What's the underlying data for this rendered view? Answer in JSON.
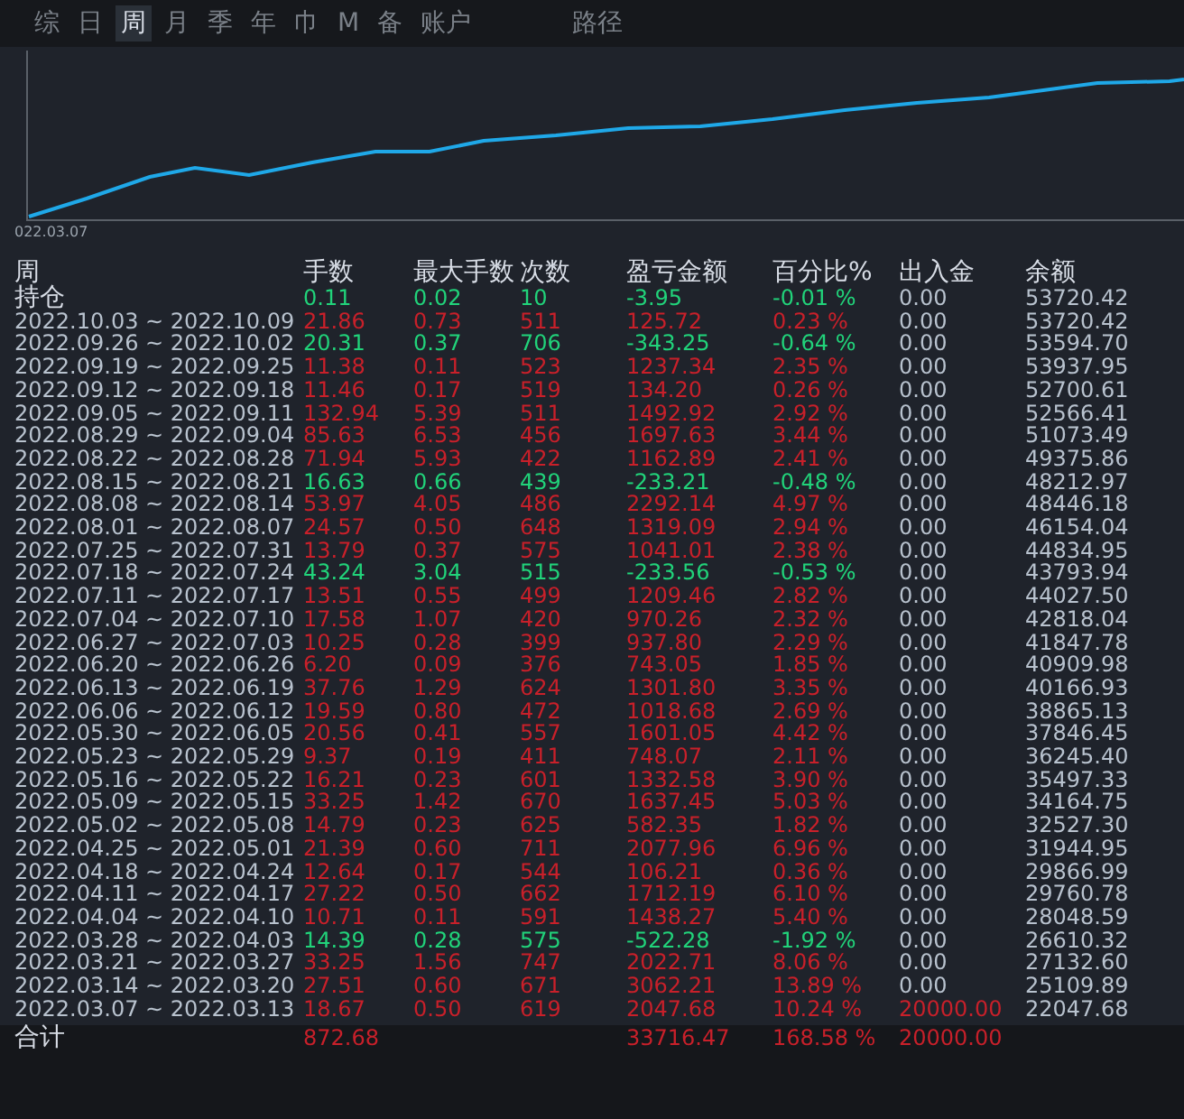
{
  "tabs": [
    {
      "label": "综",
      "selected": false
    },
    {
      "label": "日",
      "selected": false
    },
    {
      "label": "周",
      "selected": true
    },
    {
      "label": "月",
      "selected": false
    },
    {
      "label": "季",
      "selected": false
    },
    {
      "label": "年",
      "selected": false
    },
    {
      "label": "巾",
      "selected": false
    },
    {
      "label": "M",
      "selected": false
    },
    {
      "label": "备",
      "selected": false
    },
    {
      "label": "账户",
      "selected": false
    }
  ],
  "path_label": "路径",
  "chart": {
    "start_label": "022.03.07"
  },
  "table": {
    "columns": [
      "周",
      "手数",
      "最大手数",
      "次数",
      "盈亏金额",
      "百分比%",
      "出入金",
      "余额"
    ],
    "rows": [
      {
        "cells": [
          "持仓",
          "0.11",
          "0.02",
          "10",
          "-3.95",
          "-0.01 %",
          "0.00",
          "53720.42"
        ],
        "kind": "loss"
      },
      {
        "cells": [
          "2022.10.03 ~ 2022.10.09",
          "21.86",
          "0.73",
          "511",
          "125.72",
          "0.23 %",
          "0.00",
          "53720.42"
        ],
        "kind": "gain"
      },
      {
        "cells": [
          "2022.09.26 ~ 2022.10.02",
          "20.31",
          "0.37",
          "706",
          "-343.25",
          "-0.64 %",
          "0.00",
          "53594.70"
        ],
        "kind": "loss"
      },
      {
        "cells": [
          "2022.09.19 ~ 2022.09.25",
          "11.38",
          "0.11",
          "523",
          "1237.34",
          "2.35 %",
          "0.00",
          "53937.95"
        ],
        "kind": "gain"
      },
      {
        "cells": [
          "2022.09.12 ~ 2022.09.18",
          "11.46",
          "0.17",
          "519",
          "134.20",
          "0.26 %",
          "0.00",
          "52700.61"
        ],
        "kind": "gain"
      },
      {
        "cells": [
          "2022.09.05 ~ 2022.09.11",
          "132.94",
          "5.39",
          "511",
          "1492.92",
          "2.92 %",
          "0.00",
          "52566.41"
        ],
        "kind": "gain"
      },
      {
        "cells": [
          "2022.08.29 ~ 2022.09.04",
          "85.63",
          "6.53",
          "456",
          "1697.63",
          "3.44 %",
          "0.00",
          "51073.49"
        ],
        "kind": "gain"
      },
      {
        "cells": [
          "2022.08.22 ~ 2022.08.28",
          "71.94",
          "5.93",
          "422",
          "1162.89",
          "2.41 %",
          "0.00",
          "49375.86"
        ],
        "kind": "gain"
      },
      {
        "cells": [
          "2022.08.15 ~ 2022.08.21",
          "16.63",
          "0.66",
          "439",
          "-233.21",
          "-0.48 %",
          "0.00",
          "48212.97"
        ],
        "kind": "loss"
      },
      {
        "cells": [
          "2022.08.08 ~ 2022.08.14",
          "53.97",
          "4.05",
          "486",
          "2292.14",
          "4.97 %",
          "0.00",
          "48446.18"
        ],
        "kind": "gain"
      },
      {
        "cells": [
          "2022.08.01 ~ 2022.08.07",
          "24.57",
          "0.50",
          "648",
          "1319.09",
          "2.94 %",
          "0.00",
          "46154.04"
        ],
        "kind": "gain"
      },
      {
        "cells": [
          "2022.07.25 ~ 2022.07.31",
          "13.79",
          "0.37",
          "575",
          "1041.01",
          "2.38 %",
          "0.00",
          "44834.95"
        ],
        "kind": "gain"
      },
      {
        "cells": [
          "2022.07.18 ~ 2022.07.24",
          "43.24",
          "3.04",
          "515",
          "-233.56",
          "-0.53 %",
          "0.00",
          "43793.94"
        ],
        "kind": "loss"
      },
      {
        "cells": [
          "2022.07.11 ~ 2022.07.17",
          "13.51",
          "0.55",
          "499",
          "1209.46",
          "2.82 %",
          "0.00",
          "44027.50"
        ],
        "kind": "gain"
      },
      {
        "cells": [
          "2022.07.04 ~ 2022.07.10",
          "17.58",
          "1.07",
          "420",
          "970.26",
          "2.32 %",
          "0.00",
          "42818.04"
        ],
        "kind": "gain"
      },
      {
        "cells": [
          "2022.06.27 ~ 2022.07.03",
          "10.25",
          "0.28",
          "399",
          "937.80",
          "2.29 %",
          "0.00",
          "41847.78"
        ],
        "kind": "gain"
      },
      {
        "cells": [
          "2022.06.20 ~ 2022.06.26",
          "6.20",
          "0.09",
          "376",
          "743.05",
          "1.85 %",
          "0.00",
          "40909.98"
        ],
        "kind": "gain"
      },
      {
        "cells": [
          "2022.06.13 ~ 2022.06.19",
          "37.76",
          "1.29",
          "624",
          "1301.80",
          "3.35 %",
          "0.00",
          "40166.93"
        ],
        "kind": "gain"
      },
      {
        "cells": [
          "2022.06.06 ~ 2022.06.12",
          "19.59",
          "0.80",
          "472",
          "1018.68",
          "2.69 %",
          "0.00",
          "38865.13"
        ],
        "kind": "gain"
      },
      {
        "cells": [
          "2022.05.30 ~ 2022.06.05",
          "20.56",
          "0.41",
          "557",
          "1601.05",
          "4.42 %",
          "0.00",
          "37846.45"
        ],
        "kind": "gain"
      },
      {
        "cells": [
          "2022.05.23 ~ 2022.05.29",
          "9.37",
          "0.19",
          "411",
          "748.07",
          "2.11 %",
          "0.00",
          "36245.40"
        ],
        "kind": "gain"
      },
      {
        "cells": [
          "2022.05.16 ~ 2022.05.22",
          "16.21",
          "0.23",
          "601",
          "1332.58",
          "3.90 %",
          "0.00",
          "35497.33"
        ],
        "kind": "gain"
      },
      {
        "cells": [
          "2022.05.09 ~ 2022.05.15",
          "33.25",
          "1.42",
          "670",
          "1637.45",
          "5.03 %",
          "0.00",
          "34164.75"
        ],
        "kind": "gain"
      },
      {
        "cells": [
          "2022.05.02 ~ 2022.05.08",
          "14.79",
          "0.23",
          "625",
          "582.35",
          "1.82 %",
          "0.00",
          "32527.30"
        ],
        "kind": "gain"
      },
      {
        "cells": [
          "2022.04.25 ~ 2022.05.01",
          "21.39",
          "0.60",
          "711",
          "2077.96",
          "6.96 %",
          "0.00",
          "31944.95"
        ],
        "kind": "gain"
      },
      {
        "cells": [
          "2022.04.18 ~ 2022.04.24",
          "12.64",
          "0.17",
          "544",
          "106.21",
          "0.36 %",
          "0.00",
          "29866.99"
        ],
        "kind": "gain"
      },
      {
        "cells": [
          "2022.04.11 ~ 2022.04.17",
          "27.22",
          "0.50",
          "662",
          "1712.19",
          "6.10 %",
          "0.00",
          "29760.78"
        ],
        "kind": "gain"
      },
      {
        "cells": [
          "2022.04.04 ~ 2022.04.10",
          "10.71",
          "0.11",
          "591",
          "1438.27",
          "5.40 %",
          "0.00",
          "28048.59"
        ],
        "kind": "gain"
      },
      {
        "cells": [
          "2022.03.28 ~ 2022.04.03",
          "14.39",
          "0.28",
          "575",
          "-522.28",
          "-1.92 %",
          "0.00",
          "26610.32"
        ],
        "kind": "loss"
      },
      {
        "cells": [
          "2022.03.21 ~ 2022.03.27",
          "33.25",
          "1.56",
          "747",
          "2022.71",
          "8.06 %",
          "0.00",
          "27132.60"
        ],
        "kind": "gain"
      },
      {
        "cells": [
          "2022.03.14 ~ 2022.03.20",
          "27.51",
          "0.60",
          "671",
          "3062.21",
          "13.89 %",
          "0.00",
          "25109.89"
        ],
        "kind": "gain"
      },
      {
        "cells": [
          "2022.03.07 ~ 2022.03.13",
          "18.67",
          "0.50",
          "619",
          "2047.68",
          "10.24 %",
          "20000.00",
          "22047.68"
        ],
        "kind": "gain"
      }
    ],
    "total": {
      "label": "合计",
      "lots": "872.68",
      "pnl": "33716.47",
      "pct": "168.58 %",
      "inout": "20000.00"
    }
  }
}
